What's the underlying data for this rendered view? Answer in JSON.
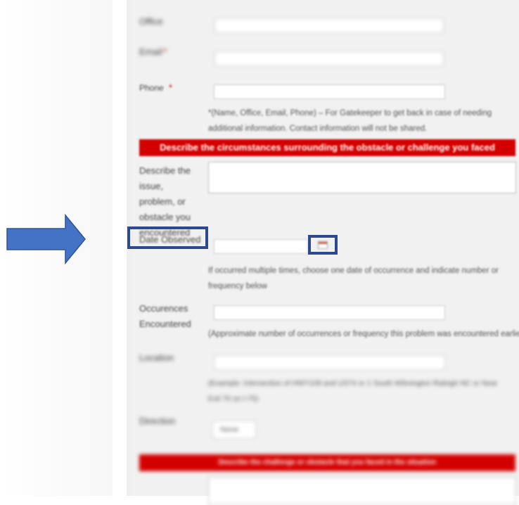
{
  "form": {
    "office_label": "Office",
    "email_label": "Email",
    "phone_label": "Phone",
    "required_mark": "*",
    "contact_note": "*(Name, Office, Email, Phone) – For Gatekeeper to get back in case of needing additional information. Contact information will not be shared.",
    "section_heading": "Describe the circumstances surrounding the obstacle or challenge you faced",
    "issue_label_lines": [
      "Describe the issue,",
      "problem, or",
      "obstacle you",
      "encountered"
    ],
    "date_label": "Date Observed",
    "date_value": "",
    "date_hint": "If occurred multiple times, choose one date of occurrence and indicate number or frequency below",
    "occurrences_label_lines": [
      "Occurences",
      "Encountered"
    ],
    "occurrences_hint": "(Approximate number of occurrences or frequency this problem was encountered earlier)",
    "location_label": "Location",
    "location_hint": "(Example: Intersection of HWY109 and US74 or 1 South Wilmington Raleigh NC or Near Exit 70 on I-75)",
    "direction_label": "Direction",
    "direction_value": "None",
    "next_section_heading": "Describe the challenge or obstacle that you faced in the situation"
  },
  "annotation": {
    "arrow_color": "#4472c4",
    "highlight_color": "#2c4a8f",
    "accent_red": "#d40000"
  }
}
